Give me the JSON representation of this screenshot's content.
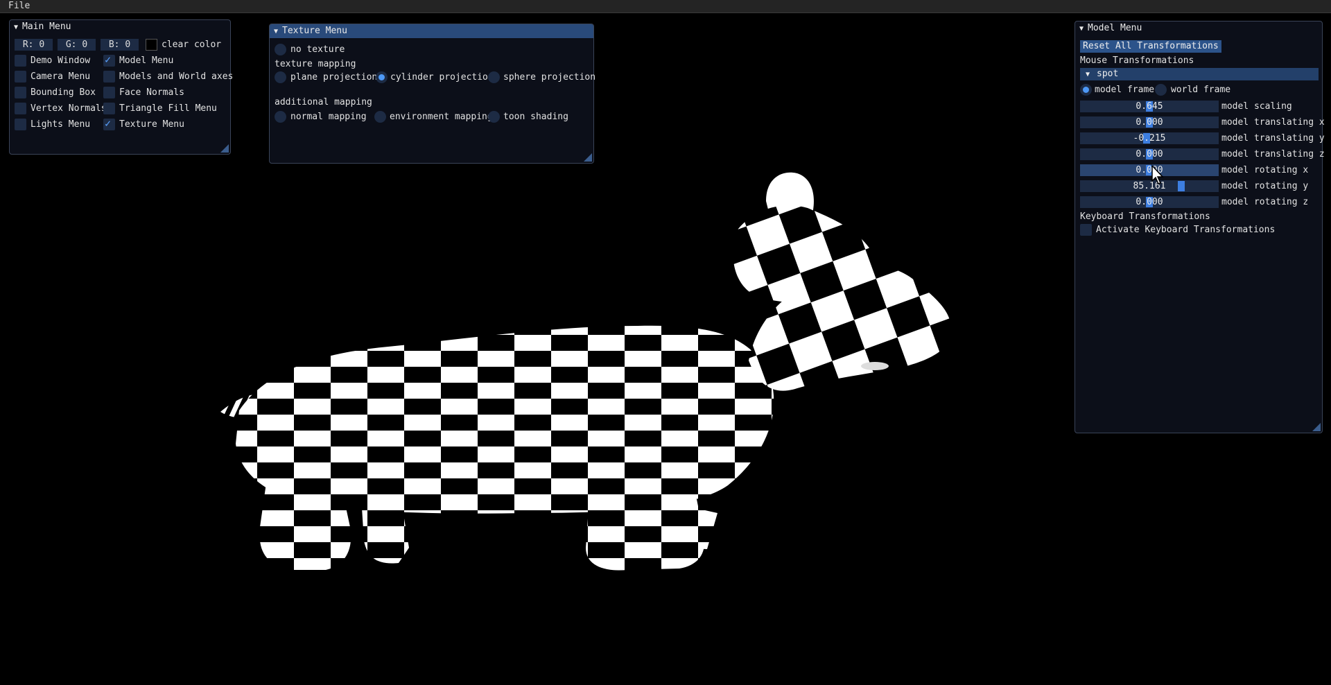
{
  "menubar": {
    "file": "File"
  },
  "main_menu": {
    "title": "Main Menu",
    "r_label": "R:",
    "r_value": "0",
    "g_label": "G:",
    "g_value": "0",
    "b_label": "B:",
    "b_value": "0",
    "clear_color": "clear color",
    "clear_color_swatch": "#000000",
    "options": [
      {
        "label": "Demo Window",
        "checked": false
      },
      {
        "label": "Model Menu",
        "checked": true
      },
      {
        "label": "Camera Menu",
        "checked": false
      },
      {
        "label": "Models and World axes",
        "checked": false
      },
      {
        "label": "Bounding Box",
        "checked": false
      },
      {
        "label": "Face Normals",
        "checked": false
      },
      {
        "label": "Vertex Normals",
        "checked": false
      },
      {
        "label": "Triangle Fill Menu",
        "checked": false
      },
      {
        "label": "Lights Menu",
        "checked": false
      },
      {
        "label": "Texture Menu",
        "checked": true
      }
    ]
  },
  "texture_menu": {
    "title": "Texture Menu",
    "no_texture": "no texture",
    "texture_mapping_heading": "texture mapping",
    "plane": "plane projection",
    "cylinder": "cylinder projection",
    "sphere": "sphere projection",
    "selected_projection": "cylinder projection",
    "additional_heading": "additional mapping",
    "normal_mapping": "normal mapping",
    "environment_mapping": "environment mapping",
    "toon_shading": "toon shading"
  },
  "model_menu": {
    "title": "Model Menu",
    "reset_button": "Reset All Transformations",
    "mouse_heading": "Mouse Transformations",
    "model_name": "spot",
    "model_frame": "model frame",
    "world_frame": "world frame",
    "selected_frame": "model frame",
    "sliders": [
      {
        "label": "model scaling",
        "value": "0.645",
        "fraction": 0.5
      },
      {
        "label": "model translating x",
        "value": "0.000",
        "fraction": 0.5
      },
      {
        "label": "model translating y",
        "value": "-0.215",
        "fraction": 0.48
      },
      {
        "label": "model translating z",
        "value": "0.000",
        "fraction": 0.5
      },
      {
        "label": "model rotating x",
        "value": "0.000",
        "fraction": 0.5
      },
      {
        "label": "model rotating y",
        "value": "85.161",
        "fraction": 0.74
      },
      {
        "label": "model rotating z",
        "value": "0.000",
        "fraction": 0.5
      }
    ],
    "keyboard_heading": "Keyboard Transformations",
    "keyboard_checkbox": "Activate Keyboard Transformations"
  },
  "scene": {
    "model_texture": "checkerboard",
    "texture_colors": [
      "#ffffff",
      "#000000"
    ]
  }
}
